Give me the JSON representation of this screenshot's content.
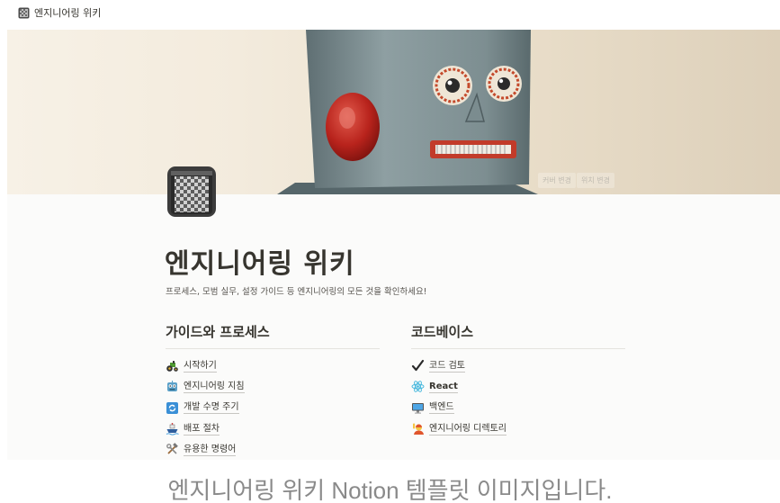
{
  "breadcrumb": {
    "icon": "checkered-notebook-icon",
    "label": "엔지니어링 위키"
  },
  "cover": {
    "change_cover_label": "커버 변경",
    "reposition_label": "위치 변경"
  },
  "page": {
    "icon": "checkered-notebook-icon",
    "title": "엔지니어링 위키",
    "subtitle": "프로세스, 모범 실무, 설정 가이드 등 엔지니어링의 모든 것을 확인하세요!"
  },
  "sections": {
    "left": {
      "heading": "가이드와 프로세스",
      "items": [
        {
          "icon": "tractor-icon",
          "label": "시작하기"
        },
        {
          "icon": "robot-icon",
          "label": "엔지니어링 지침"
        },
        {
          "icon": "cycle-arrows-icon",
          "label": "개발 수명 주기"
        },
        {
          "icon": "ship-icon",
          "label": "배포 절차"
        },
        {
          "icon": "hammer-wrench-icon",
          "label": "유용한 명령어"
        }
      ]
    },
    "right": {
      "heading": "코드베이스",
      "items": [
        {
          "icon": "checkmark-icon",
          "label": "코드 검토"
        },
        {
          "icon": "react-atom-icon",
          "label": "React"
        },
        {
          "icon": "desktop-computer-icon",
          "label": "백엔드"
        },
        {
          "icon": "person-raising-hand-icon",
          "label": "엔지니어링 디렉토리"
        }
      ]
    }
  },
  "caption": "엔지니어링 위키 Notion 템플릿 이미지입니다.",
  "colors": {
    "text": "#37352f",
    "page_bg": "#fbfbfa",
    "caption": "#8a8a8a"
  }
}
